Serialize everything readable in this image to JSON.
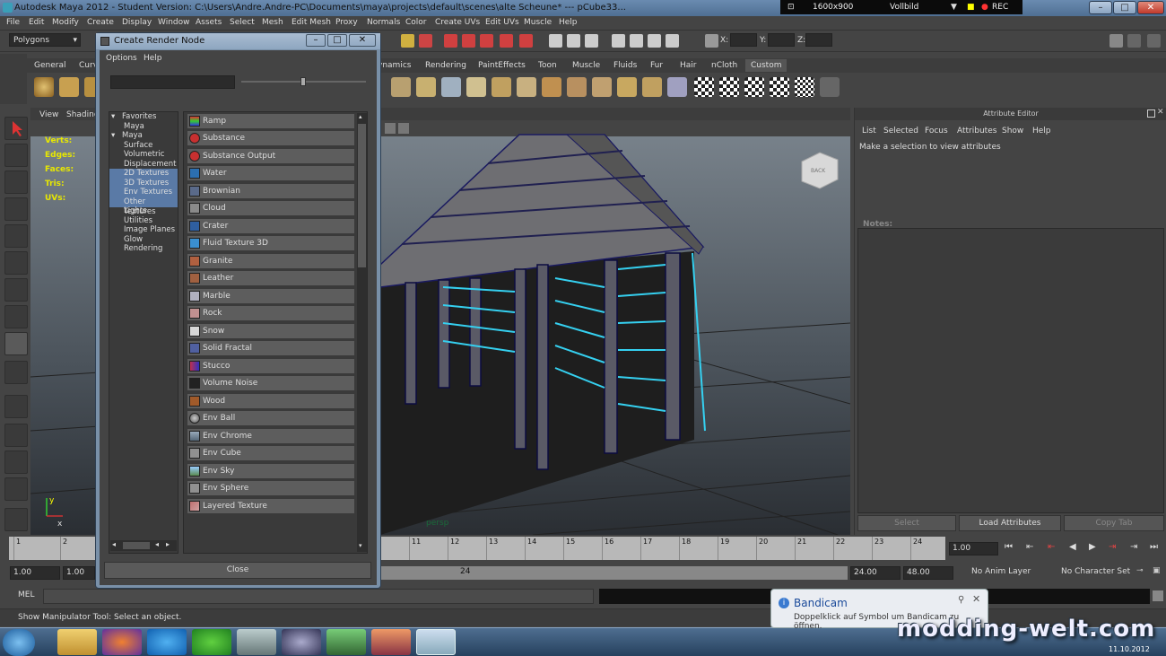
{
  "window": {
    "title": "Autodesk Maya 2012 - Student Version: C:\\Users\\Andre.Andre-PC\\Documents\\maya\\projects\\default\\scenes\\alte Scheune*   ---   pCube33...",
    "recorder": {
      "resolution": "1600x900",
      "mode": "Vollbild",
      "rec": "REC"
    }
  },
  "menubar": [
    "File",
    "Edit",
    "Modify",
    "Create",
    "Display",
    "Window",
    "Assets",
    "Select",
    "Mesh",
    "Edit Mesh",
    "Proxy",
    "Normals",
    "Color",
    "Create UVs",
    "Edit UVs",
    "Muscle",
    "Help"
  ],
  "statusline": {
    "menuset": "Polygons",
    "x_label": "X:",
    "y_label": "Y:",
    "z_label": "Z:"
  },
  "shelf": {
    "tabs": [
      "General",
      "Curv",
      "ynamics",
      "Rendering",
      "PaintEffects",
      "Toon",
      "Muscle",
      "Fluids",
      "Fur",
      "Hair",
      "nCloth",
      "Custom"
    ]
  },
  "viewport": {
    "menu": [
      "View",
      "Shading"
    ],
    "hud": [
      "Verts:",
      "Edges:",
      "Faces:",
      "Tris:",
      "UVs:"
    ],
    "camera": "persp",
    "viewcube": "BACK",
    "axis_y": "y",
    "axis_x": "x"
  },
  "attribute_editor": {
    "header": "Attribute Editor",
    "menu": [
      "List",
      "Selected",
      "Focus",
      "Attributes",
      "Show",
      "Help"
    ],
    "message": "Make a selection to view attributes",
    "notes_label": "Notes:",
    "buttons": [
      "Select",
      "Load Attributes",
      "Copy Tab"
    ]
  },
  "dialog": {
    "title": "Create Render Node",
    "menu": [
      "Options",
      "Help"
    ],
    "categories": [
      {
        "label": "Favorites",
        "level": 0,
        "selected": false
      },
      {
        "label": "Maya",
        "level": 1,
        "selected": false
      },
      {
        "label": "Maya",
        "level": 0,
        "selected": false
      },
      {
        "label": "Surface",
        "level": 1,
        "selected": false
      },
      {
        "label": "Volumetric",
        "level": 1,
        "selected": false
      },
      {
        "label": "Displacement",
        "level": 1,
        "selected": false
      },
      {
        "label": "2D Textures",
        "level": 1,
        "selected": true
      },
      {
        "label": "3D Textures",
        "level": 1,
        "selected": true
      },
      {
        "label": "Env Textures",
        "level": 1,
        "selected": true
      },
      {
        "label": "Other Textures",
        "level": 1,
        "selected": true
      },
      {
        "label": "Lights",
        "level": 1,
        "selected": false
      },
      {
        "label": "Utilities",
        "level": 1,
        "selected": false
      },
      {
        "label": "Image Planes",
        "level": 1,
        "selected": false
      },
      {
        "label": "Glow",
        "level": 1,
        "selected": false
      },
      {
        "label": "Rendering",
        "level": 1,
        "selected": false
      }
    ],
    "nodes": [
      {
        "label": "Ramp",
        "color": "#3a7fd0"
      },
      {
        "label": "Substance",
        "color": "#c83030"
      },
      {
        "label": "Substance Output",
        "color": "#c83030"
      },
      {
        "label": "Water",
        "color": "#2c6fb0"
      },
      {
        "label": "Brownian",
        "color": "#5a6a8a"
      },
      {
        "label": "Cloud",
        "color": "#8a8a8a"
      },
      {
        "label": "Crater",
        "color": "#2f5fa0"
      },
      {
        "label": "Fluid Texture 3D",
        "color": "#3a8fd0"
      },
      {
        "label": "Granite",
        "color": "#b06040"
      },
      {
        "label": "Leather",
        "color": "#a06040"
      },
      {
        "label": "Marble",
        "color": "#b0b0c0"
      },
      {
        "label": "Rock",
        "color": "#c09090"
      },
      {
        "label": "Snow",
        "color": "#d8d8d8"
      },
      {
        "label": "Solid Fractal",
        "color": "#5060a0"
      },
      {
        "label": "Stucco",
        "color": "#c03050"
      },
      {
        "label": "Volume Noise",
        "color": "#222222"
      },
      {
        "label": "Wood",
        "color": "#a05a2a"
      },
      {
        "label": "Env Ball",
        "color": "#8a8a8a"
      },
      {
        "label": "Env Chrome",
        "color": "#7080a0"
      },
      {
        "label": "Env Cube",
        "color": "#909090"
      },
      {
        "label": "Env Sky",
        "color": "#5a8a50"
      },
      {
        "label": "Env Sphere",
        "color": "#909090"
      },
      {
        "label": "Layered Texture",
        "color": "#c07070"
      }
    ],
    "close_label": "Close"
  },
  "timeslider": {
    "ticks": [
      "1",
      "2",
      "11",
      "12",
      "13",
      "14",
      "15",
      "16",
      "17",
      "18",
      "19",
      "20",
      "21",
      "22",
      "23",
      "24"
    ],
    "current": "1.00"
  },
  "range": {
    "start": "1.00",
    "start2": "1.00",
    "slider_end": "24",
    "end": "24.00",
    "end2": "48.00",
    "anim_layer": "No Anim Layer",
    "char_set": "No Character Set"
  },
  "mel": {
    "label": "MEL"
  },
  "helpline": "Show Manipulator Tool: Select an object.",
  "bandicam": {
    "title": "Bandicam",
    "text": "Doppelklick auf Symbol um Bandicam zu öffnen."
  },
  "clock": {
    "date": "11.10.2012"
  },
  "watermark": "modding-welt.com"
}
